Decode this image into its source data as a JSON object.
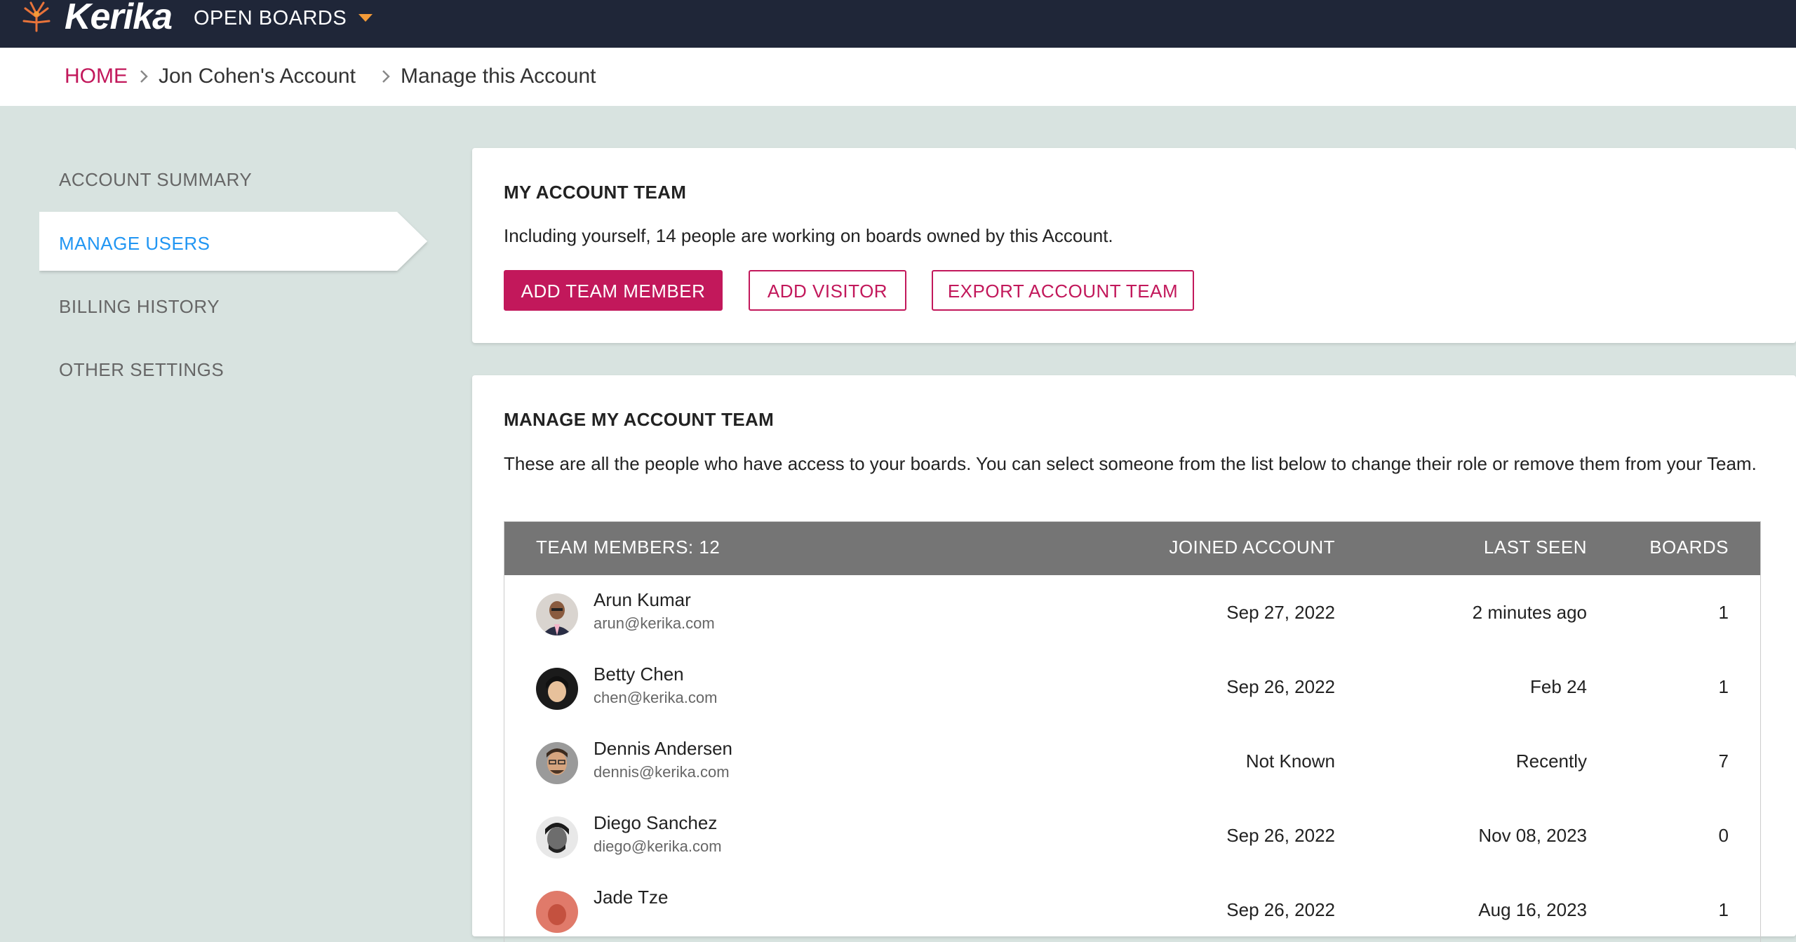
{
  "app": {
    "logo_text": "Kerika",
    "open_boards_label": "OPEN BOARDS"
  },
  "colors": {
    "accent": "#c2185b",
    "active_nav": "#2196f3",
    "topbar": "#1f2638",
    "table_header": "#757575"
  },
  "breadcrumb": {
    "home": "HOME",
    "account": "Jon Cohen's Account",
    "current": "Manage this Account"
  },
  "sidebar": {
    "items": [
      {
        "label": "ACCOUNT SUMMARY"
      },
      {
        "label": "MANAGE USERS"
      },
      {
        "label": "BILLING HISTORY"
      },
      {
        "label": "OTHER SETTINGS"
      }
    ]
  },
  "account_team": {
    "title": "MY ACCOUNT TEAM",
    "description": "Including yourself, 14 people are working on boards owned by this Account.",
    "add_member_label": "ADD TEAM MEMBER",
    "add_visitor_label": "ADD VISITOR",
    "export_label": "EXPORT ACCOUNT TEAM"
  },
  "manage_team": {
    "title": "MANAGE MY ACCOUNT TEAM",
    "description": "These are all the people who have access to your boards. You can select someone from the list below to change their role or remove them from your Team.",
    "columns": {
      "members": "TEAM MEMBERS: 12",
      "joined": "JOINED ACCOUNT",
      "seen": "LAST SEEN",
      "boards": "BOARDS"
    },
    "rows": [
      {
        "name": "Arun Kumar",
        "email": "arun@kerika.com",
        "joined": "Sep 27, 2022",
        "seen": "2 minutes ago",
        "boards": "1"
      },
      {
        "name": "Betty Chen",
        "email": "chen@kerika.com",
        "joined": "Sep 26, 2022",
        "seen": "Feb 24",
        "boards": "1"
      },
      {
        "name": "Dennis Andersen",
        "email": "dennis@kerika.com",
        "joined": "Not Known",
        "seen": "Recently",
        "boards": "7"
      },
      {
        "name": "Diego Sanchez",
        "email": "diego@kerika.com",
        "joined": "Sep 26, 2022",
        "seen": "Nov 08, 2023",
        "boards": "0"
      },
      {
        "name": "Jade Tze",
        "email": "",
        "joined": "Sep 26, 2022",
        "seen": "Aug 16, 2023",
        "boards": "1"
      }
    ]
  }
}
